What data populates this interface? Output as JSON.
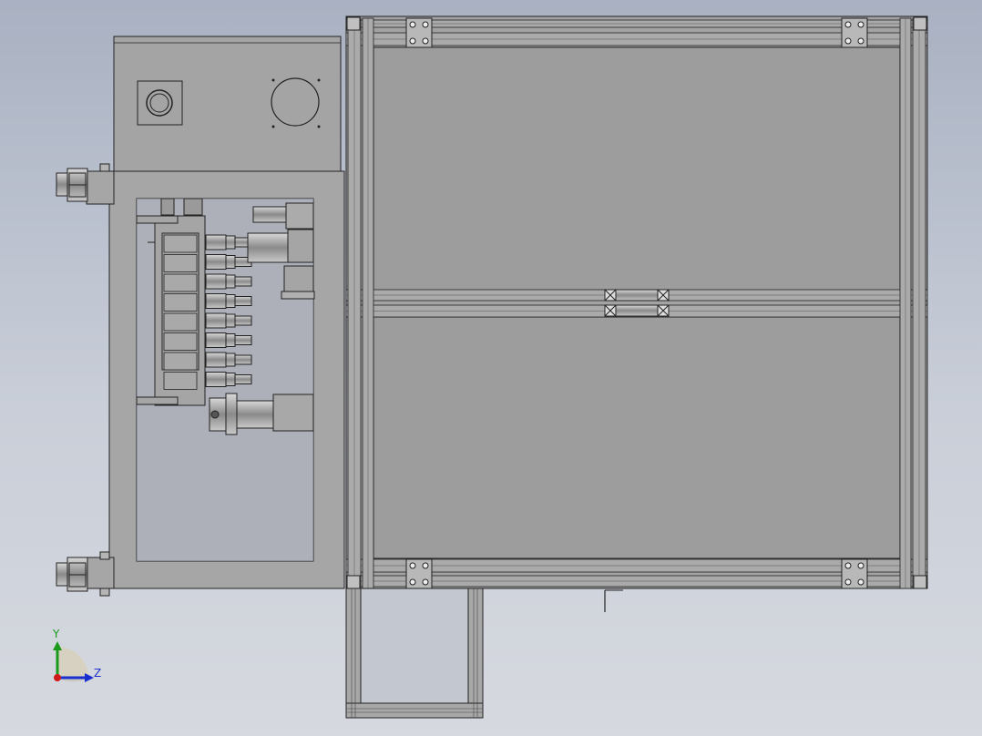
{
  "view": {
    "background_top": "#a9b1c2",
    "background_bottom": "#d6d9df",
    "part_fill": "#a3a3a3",
    "panel_fill": "#9c9c9c",
    "edge_color": "#1e1e1e"
  },
  "triad": {
    "y_label": "Y",
    "z_label": "Z",
    "y_color": "#1a9a1a",
    "z_color": "#1a2fd0",
    "x_color": "#d01a1a"
  }
}
